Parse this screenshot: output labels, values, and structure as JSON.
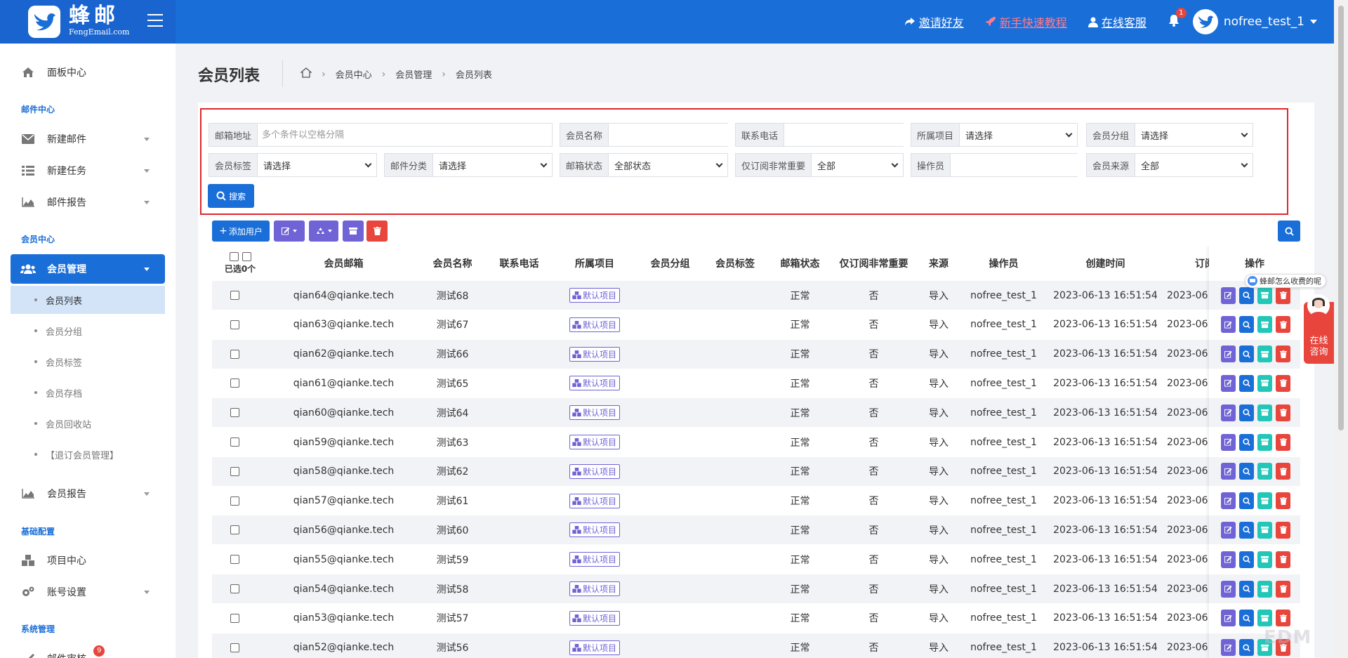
{
  "brand": {
    "name": "蜂邮",
    "sub": "FengEmail.com"
  },
  "top_nav": {
    "invite": "邀请好友",
    "tutorial": "新手快速教程",
    "service": "在线客服",
    "notif_count": "1",
    "username": "nofree_test_1"
  },
  "sidebar": {
    "dashboard": "面板中心",
    "sec_mail": "邮件中心",
    "new_mail": "新建邮件",
    "new_task": "新建任务",
    "mail_report": "邮件报告",
    "sec_member": "会员中心",
    "member_mgmt": "会员管理",
    "sub_items": [
      "会员列表",
      "会员分组",
      "会员标签",
      "会员存档",
      "会员回收站",
      "【退订会员管理】"
    ],
    "member_report": "会员报告",
    "sec_base": "基础配置",
    "project_center": "项目中心",
    "account_settings": "账号设置",
    "sec_system": "系统管理",
    "mail_audit": "邮件审核",
    "mail_audit_badge": "9"
  },
  "page": {
    "title": "会员列表",
    "breadcrumb": [
      "会员中心",
      "会员管理",
      "会员列表"
    ]
  },
  "filters": {
    "email_label": "邮箱地址",
    "email_placeholder": "多个条件以空格分隔",
    "name_label": "会员名称",
    "phone_label": "联系电话",
    "project_label": "所属项目",
    "project_value": "请选择",
    "group_label": "会员分组",
    "group_value": "请选择",
    "tag_label": "会员标签",
    "tag_value": "请选择",
    "mailcat_label": "邮件分类",
    "mailcat_value": "请选择",
    "status_label": "邮箱状态",
    "status_value": "全部状态",
    "important_label": "仅订阅非常重要",
    "important_value": "全部",
    "operator_label": "操作员",
    "source_label": "会员来源",
    "source_value": "全部",
    "search_btn": "搜索"
  },
  "toolbar": {
    "add_user": "添加用户"
  },
  "table": {
    "selected_label": "已选0个",
    "headers": {
      "email": "会员邮箱",
      "name": "会员名称",
      "phone": "联系电话",
      "project": "所属项目",
      "group": "会员分组",
      "tag": "会员标签",
      "status": "邮箱状态",
      "important": "仅订阅非常重要",
      "source": "来源",
      "operator": "操作员",
      "created": "创建时间",
      "subscribed": "订阅",
      "ops": "操作"
    },
    "rows": [
      {
        "email": "qian64@qianke.tech",
        "name": "测试68",
        "project": "默认项目",
        "status": "正常",
        "important": "否",
        "source": "导入",
        "operator": "nofree_test_1",
        "created": "2023-06-13 16:51:54",
        "subscribed": "2023-06"
      },
      {
        "email": "qian63@qianke.tech",
        "name": "测试67",
        "project": "默认项目",
        "status": "正常",
        "important": "否",
        "source": "导入",
        "operator": "nofree_test_1",
        "created": "2023-06-13 16:51:54",
        "subscribed": "2023-06"
      },
      {
        "email": "qian62@qianke.tech",
        "name": "测试66",
        "project": "默认项目",
        "status": "正常",
        "important": "否",
        "source": "导入",
        "operator": "nofree_test_1",
        "created": "2023-06-13 16:51:54",
        "subscribed": "2023-06"
      },
      {
        "email": "qian61@qianke.tech",
        "name": "测试65",
        "project": "默认项目",
        "status": "正常",
        "important": "否",
        "source": "导入",
        "operator": "nofree_test_1",
        "created": "2023-06-13 16:51:54",
        "subscribed": "2023-06"
      },
      {
        "email": "qian60@qianke.tech",
        "name": "测试64",
        "project": "默认项目",
        "status": "正常",
        "important": "否",
        "source": "导入",
        "operator": "nofree_test_1",
        "created": "2023-06-13 16:51:54",
        "subscribed": "2023-06"
      },
      {
        "email": "qian59@qianke.tech",
        "name": "测试63",
        "project": "默认项目",
        "status": "正常",
        "important": "否",
        "source": "导入",
        "operator": "nofree_test_1",
        "created": "2023-06-13 16:51:54",
        "subscribed": "2023-06"
      },
      {
        "email": "qian58@qianke.tech",
        "name": "测试62",
        "project": "默认项目",
        "status": "正常",
        "important": "否",
        "source": "导入",
        "operator": "nofree_test_1",
        "created": "2023-06-13 16:51:54",
        "subscribed": "2023-06"
      },
      {
        "email": "qian57@qianke.tech",
        "name": "测试61",
        "project": "默认项目",
        "status": "正常",
        "important": "否",
        "source": "导入",
        "operator": "nofree_test_1",
        "created": "2023-06-13 16:51:54",
        "subscribed": "2023-06"
      },
      {
        "email": "qian56@qianke.tech",
        "name": "测试60",
        "project": "默认项目",
        "status": "正常",
        "important": "否",
        "source": "导入",
        "operator": "nofree_test_1",
        "created": "2023-06-13 16:51:54",
        "subscribed": "2023-06"
      },
      {
        "email": "qian55@qianke.tech",
        "name": "测试59",
        "project": "默认项目",
        "status": "正常",
        "important": "否",
        "source": "导入",
        "operator": "nofree_test_1",
        "created": "2023-06-13 16:51:54",
        "subscribed": "2023-06"
      },
      {
        "email": "qian54@qianke.tech",
        "name": "测试58",
        "project": "默认项目",
        "status": "正常",
        "important": "否",
        "source": "导入",
        "operator": "nofree_test_1",
        "created": "2023-06-13 16:51:54",
        "subscribed": "2023-06"
      },
      {
        "email": "qian53@qianke.tech",
        "name": "测试57",
        "project": "默认项目",
        "status": "正常",
        "important": "否",
        "source": "导入",
        "operator": "nofree_test_1",
        "created": "2023-06-13 16:51:54",
        "subscribed": "2023-06"
      },
      {
        "email": "qian52@qianke.tech",
        "name": "测试56",
        "project": "默认项目",
        "status": "正常",
        "important": "否",
        "source": "导入",
        "operator": "nofree_test_1",
        "created": "2023-06-13 16:51:54",
        "subscribed": "2023-06"
      }
    ]
  },
  "float": {
    "tip": "蜂邮怎么收费的呢",
    "chat_line1": "在线",
    "chat_line2": "咨询"
  },
  "watermark": "EDM",
  "colors": {
    "primary": "#1a6ed8",
    "purple": "#6f63d6",
    "teal": "#22c7b8",
    "danger": "#e8453c"
  }
}
